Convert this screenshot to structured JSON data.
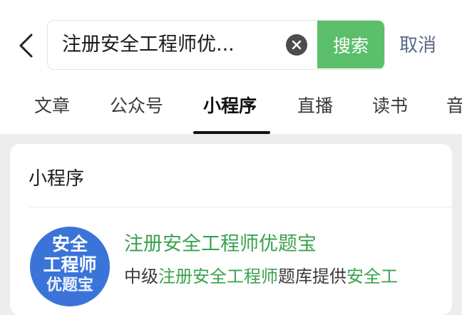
{
  "search": {
    "query": "注册安全工程师优...",
    "button_label": "搜索",
    "cancel_label": "取消"
  },
  "tabs": [
    {
      "label": "文章",
      "active": false
    },
    {
      "label": "公众号",
      "active": false
    },
    {
      "label": "小程序",
      "active": true
    },
    {
      "label": "直播",
      "active": false
    },
    {
      "label": "读书",
      "active": false
    },
    {
      "label": "音",
      "active": false
    }
  ],
  "section": {
    "title": "小程序"
  },
  "result": {
    "logo_lines": [
      "安全",
      "工程师",
      "优题宝"
    ],
    "name": "注册安全工程师优题宝",
    "desc_parts": [
      {
        "text": "中级",
        "highlight": false
      },
      {
        "text": "注册安全工程师",
        "highlight": true
      },
      {
        "text": "题库提供",
        "highlight": false
      },
      {
        "text": "安全工",
        "highlight": true
      }
    ]
  },
  "colors": {
    "accent_green": "#5cbf6b",
    "highlight_green": "#3aa14f",
    "cancel_blue": "#5a6b85",
    "logo_blue": "#3a74d9"
  }
}
